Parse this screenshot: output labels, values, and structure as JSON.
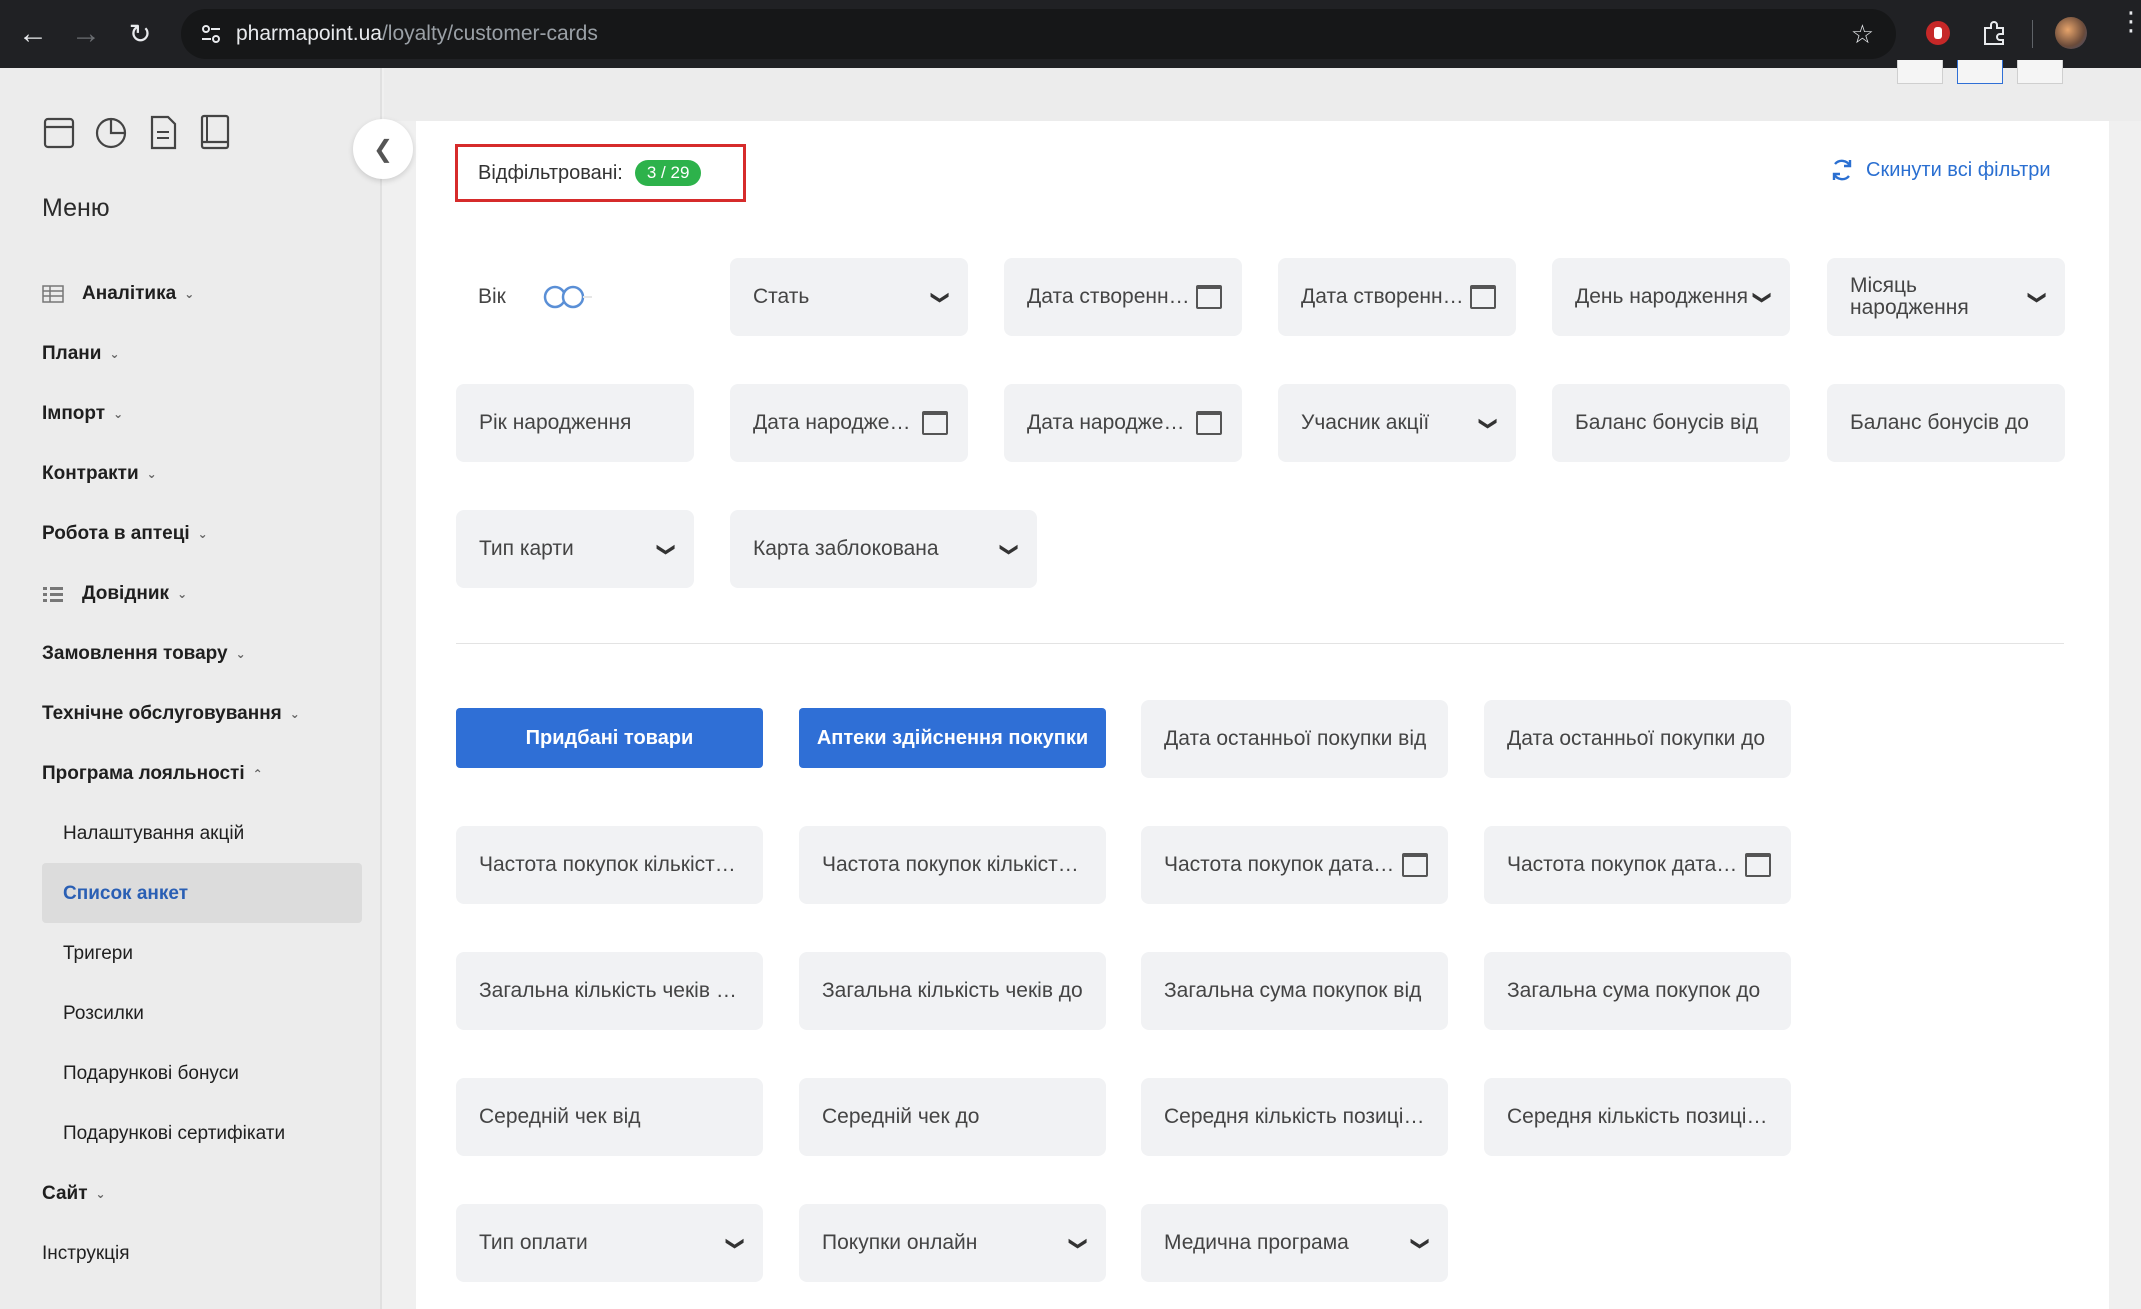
{
  "browser": {
    "url_domain": "pharmapoint.ua",
    "url_path": "/loyalty/customer-cards"
  },
  "sidebar": {
    "menu_title": "Меню",
    "items": [
      {
        "label": "Аналітика"
      },
      {
        "label": "Плани"
      },
      {
        "label": "Імпорт"
      },
      {
        "label": "Контракти"
      },
      {
        "label": "Робота в аптеці"
      },
      {
        "label": "Довідник"
      },
      {
        "label": "Замовлення товару"
      },
      {
        "label": "Технічне обслуговування"
      },
      {
        "label": "Програма лояльності"
      },
      {
        "label": "Налаштування акцій"
      },
      {
        "label": "Список анкет"
      },
      {
        "label": "Тригери"
      },
      {
        "label": "Розсилки"
      },
      {
        "label": "Подарункові бонуси"
      },
      {
        "label": "Подарункові сертифікати"
      },
      {
        "label": "Сайт"
      },
      {
        "label": "Інструкція"
      }
    ]
  },
  "filters_header": {
    "filtered_label": "Відфільтровані:",
    "count": "3 / 29",
    "reset_label": "Скинути всі фільтри"
  },
  "filters": {
    "age": "Вік",
    "gender": "Стать",
    "created_from": "Дата створення від",
    "created_to": "Дата створення до",
    "birth_day": "День народження",
    "birth_month": "Місяць народження",
    "birth_year": "Рік народження",
    "birth_date_from": "Дата народження від",
    "birth_date_to": "Дата народження до",
    "promo_participant": "Учасник акції",
    "bonus_from": "Баланс бонусів від",
    "bonus_to": "Баланс бонусів до",
    "card_type": "Тип карти",
    "card_blocked": "Карта заблокована"
  },
  "purchase_filters": {
    "btn_bought": "Придбані товари",
    "btn_pharmacies": "Аптеки здійснення покупки",
    "last_purchase_from": "Дата останньої покупки від",
    "last_purchase_to": "Дата останньої покупки до",
    "freq_count_from": "Частота покупок кількість від",
    "freq_count_to": "Частота покупок кількість до",
    "freq_date_from": "Частота покупок дата від",
    "freq_date_to": "Частота покупок дата до",
    "checks_from": "Загальна кількість чеків від",
    "checks_to": "Загальна кількість чеків до",
    "sum_from": "Загальна сума покупок від",
    "sum_to": "Загальна сума покупок до",
    "avg_check_from": "Середній чек від",
    "avg_check_to": "Середній чек до",
    "avg_positions_from": "Середня кількість позицій від",
    "avg_positions_to": "Середня кількість позицій до",
    "payment_type": "Тип оплати",
    "online": "Покупки онлайн",
    "medical": "Медична програма"
  },
  "colors": {
    "accent": "#2f6fd6",
    "badge": "#2db24b",
    "highlight_border": "#d62b2b"
  }
}
